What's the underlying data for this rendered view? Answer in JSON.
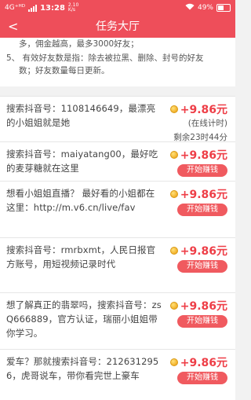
{
  "statusbar": {
    "carrier": "4G⁺ᴴᴰ",
    "time": "13:28",
    "speed": "2.10\nK/s",
    "battery": "49%"
  },
  "header": {
    "back": "<",
    "title": "任务大厅"
  },
  "rules": {
    "line1": "多，佣金越高，最多3000好友；",
    "line2": "5、 有效好友数是指：除去被拉黑、删除、封号的好友",
    "line3": "数；好友数量每日更新。"
  },
  "tasks": [
    {
      "desc": "搜索抖音号：1108146649，最漂亮的小姐姐就是她",
      "amount": "+9.86元",
      "status_online": "(在线计时)",
      "status_left": "剩余23时44分"
    },
    {
      "desc": "搜索抖音号：maiyatang00，最好吃的麦芽糖就在这里",
      "amount": "+9.86元",
      "button": "开始赚钱"
    },
    {
      "desc": "想看小姐姐直播？ 最好看的小姐都在这里：http://m.v6.cn/live/fav",
      "amount": "+9.86元",
      "button": "开始赚钱"
    },
    {
      "desc": "搜索抖音号：rmrbxmt，人民日报官方账号，用短视频记录时代",
      "amount": "+9.86元",
      "button": "开始赚钱"
    },
    {
      "desc": "想了解真正的翡翠吗，搜索抖音号：zsQ666889，官方认证，瑞丽小姐姐带你学习。",
      "amount": "+9.86元",
      "button": "开始赚钱"
    },
    {
      "desc": "爱车？那就搜索抖音号：2126312956，虎哥说车，带你看完世上豪车",
      "amount": "+9.86元",
      "button": "开始赚钱"
    }
  ]
}
